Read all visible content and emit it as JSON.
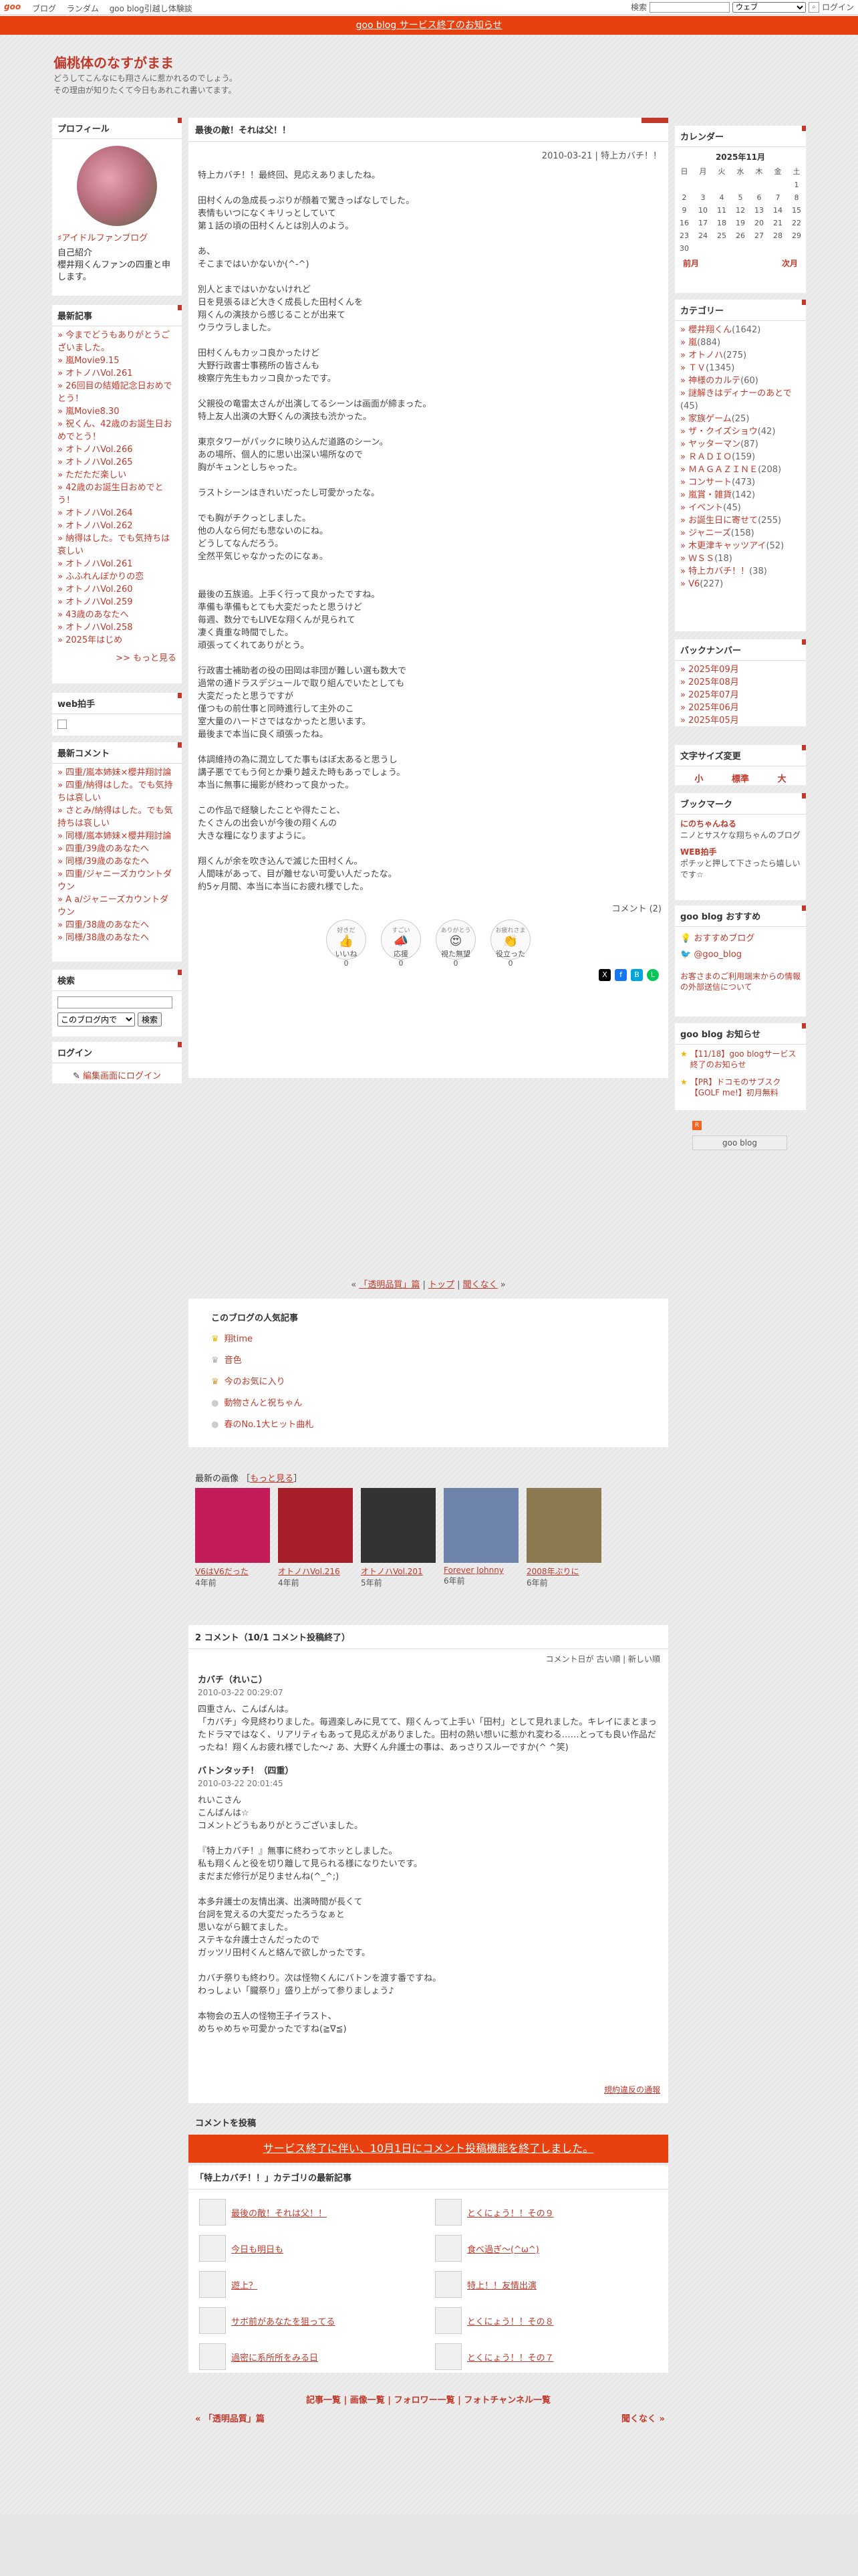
{
  "topbar": {
    "logo": "goo",
    "links": [
      "ブログ",
      "ランダム",
      "goo blog引越し体験談"
    ],
    "search_label": "検索",
    "search_select": "ウェブ",
    "login": "ログイン"
  },
  "notice": "goo blog サービス終了のお知らせ",
  "blog": {
    "title": "偏桃体のなすがまま",
    "desc1": "どうしてこんなにも翔さんに惹かれるのでしょう。",
    "desc2": "その理由が知りたくて今日もあれこれ書いてます。"
  },
  "profile": {
    "heading": "プロフィール",
    "fan": "♯アイドルファンブログ",
    "intro_label": "自己紹介",
    "intro": "櫻井翔くんファンの四重と申します。"
  },
  "recent": {
    "heading": "最新記事",
    "items": [
      "今までどうもありがとうございました。",
      "嵐Movie9.15",
      "オトノハVol.261",
      "26回目の結婚記念日おめでとう！",
      "嵐Movie8.30",
      "祝くん、42歳のお誕生日おめでとう！",
      "オトノハVol.266",
      "オトノハVol.265",
      "ただただ楽しい",
      "42歳のお誕生日おめでとう！",
      "オトノハVol.264",
      "オトノハVol.262",
      "納得はした。でも気持ちは哀しい",
      "オトノハVol.261",
      "ふふれんぼかりの恋",
      "オトノハVol.260",
      "オトノハVol.259",
      "43歳のあなたへ",
      "オトノハVol.258",
      "2025年はじめ"
    ],
    "more": ">> もっと見る"
  },
  "webclap": {
    "heading": "web拍手"
  },
  "comments": {
    "heading": "最新コメント",
    "items": [
      "四重/嵐本姉妹×櫻井翔討論",
      "四重/納得はした。でも気持ちは哀しい",
      "さとみ/納得はした。でも気持ちは哀しい",
      "同様/嵐本姉妹×櫻井翔討論",
      "四重/39歳のあなたへ",
      "同様/39歳のあなたへ",
      "四重/ジャニーズカウントダウン",
      "A a/ジャニーズカウントダウン",
      "四重/38歳のあなたへ",
      "同様/38歳のあなたへ"
    ]
  },
  "search": {
    "heading": "検索",
    "select": "このブログ内で",
    "button": "検索"
  },
  "login": {
    "heading": "ログイン",
    "link": "編集画面にログイン"
  },
  "article": {
    "heading": "最後の敵！それは父！！",
    "meta": "2010-03-21 | 特上カバチ！！",
    "body": "特上カバチ！！最終回、見応えありましたね。\n\n田村くんの急成長っぷりが顔着で驚きっぱなしでした。\n表情もいつになくキリっとしていて\n第１話の頃の田村くんとは別人のよう。\n\nあ、\nそこまではいかないか(^-^)\n\n別人とまではいかないけれど\n日を見張るほど大きく成長した田村くんを\n翔くんの演技から感じることが出来て\nウラウラしました。\n\n田村くんもカッコ良かったけど\n大野行政書士事務所の皆さんも\n検察庁先生もカッコ良かったです。\n\n父親役の竜雷太さんが出演してるシーンは画面が締まった。\n特上友人出演の大野くんの演技も渋かった。\n\n東京タワーがパックに映り込んだ道路のシーン。\nあの場所、個人的に思い出深い場所なので\n胸がキュンとしちゃった。\n\nラストシーンはきれいだったし可愛かったな。\n\nでも胸がチクっとしました。\n他の人なら何だも悲ないのにね。\nどうしてなんだろう。\n全然平気じゃなかったのになぁ。\n\n\n最後の五族追。上手く行って良かったですね。\n準備も準備もとても大変だったと思うけど\n毎週、数分でもLIVEな翔くんが見られて\n凄く貴重な時間でした。\n頑張ってくれてありがとう。\n\n行政書士補助者の役の田岡は非団が難しい選も数大で\n過常の通ドラスデジュールで取り組んでいたとしても\n大変だったと思うですが\n僅つもの前仕事と同時進行して主外のこ\n室大量のハードさではなかったと思います。\n最後まで本当に良く頑張ったね。\n\n体調維持の為に潤立してた事もはぼ太あると思うし\n講子悪でてもう何とか乗り越えた時もあっでしょう。\n本当に無事に撮影が終わって良かった。\n\nこの作品で経験したことや得たこと、\nたくさんの出会いが今後の翔くんの\n大きな糧になりますように。\n\n翔くんが余を吹き込んで滅じた田村くん。\n人間味があって、目が離せない可愛い人だったな。\n約5ヶ月間、本当に本当にお疲れ様でした。",
    "comment_link": "コメント (2)",
    "reactions": [
      {
        "top": "好きだ",
        "label": "いいね",
        "count": "0"
      },
      {
        "top": "すごい",
        "label": "応援",
        "count": "0"
      },
      {
        "top": "ありがとう",
        "label": "視た無望",
        "count": "0"
      },
      {
        "top": "お疲れさま",
        "label": "役立った",
        "count": "0"
      }
    ]
  },
  "calendar": {
    "heading": "カレンダー",
    "month": "2025年11月",
    "dow": [
      "日",
      "月",
      "火",
      "水",
      "木",
      "金",
      "土"
    ],
    "weeks": [
      [
        "",
        "",
        "",
        "",
        "",
        "",
        "1"
      ],
      [
        "2",
        "3",
        "4",
        "5",
        "6",
        "7",
        "8"
      ],
      [
        "9",
        "10",
        "11",
        "12",
        "13",
        "14",
        "15"
      ],
      [
        "16",
        "17",
        "18",
        "19",
        "20",
        "21",
        "22"
      ],
      [
        "23",
        "24",
        "25",
        "26",
        "27",
        "28",
        "29"
      ],
      [
        "30",
        "",
        "",
        "",
        "",
        "",
        ""
      ]
    ],
    "prev": "前月",
    "next": "次月"
  },
  "category": {
    "heading": "カテゴリー",
    "items": [
      {
        "n": "櫻井翔くん",
        "c": "(1642)"
      },
      {
        "n": "嵐",
        "c": "(884)"
      },
      {
        "n": "オトノハ",
        "c": "(275)"
      },
      {
        "n": "ＴＶ",
        "c": "(1345)"
      },
      {
        "n": "神様のカルテ",
        "c": "(60)"
      },
      {
        "n": "謎解きはディナーのあとで",
        "c": "(45)"
      },
      {
        "n": "家族ゲーム",
        "c": "(25)"
      },
      {
        "n": "ザ・クイズショウ",
        "c": "(42)"
      },
      {
        "n": "ヤッターマン",
        "c": "(87)"
      },
      {
        "n": "ＲＡＤＩＯ",
        "c": "(159)"
      },
      {
        "n": "ＭＡＧＡＺＩＮＥ",
        "c": "(208)"
      },
      {
        "n": "コンサート",
        "c": "(473)"
      },
      {
        "n": "嵐賞・雑貨",
        "c": "(142)"
      },
      {
        "n": "イベント",
        "c": "(45)"
      },
      {
        "n": "お誕生日に寄せて",
        "c": "(255)"
      },
      {
        "n": "ジャニーズ",
        "c": "(158)"
      },
      {
        "n": "木更津キャッツアイ",
        "c": "(52)"
      },
      {
        "n": "ＷＳＳ",
        "c": "(18)"
      },
      {
        "n": "特上カバチ！！",
        "c": "(38)"
      },
      {
        "n": "V6",
        "c": "(227)"
      }
    ]
  },
  "backnumber": {
    "heading": "バックナンバー",
    "items": [
      "2025年09月",
      "2025年08月",
      "2025年07月",
      "2025年06月",
      "2025年05月"
    ]
  },
  "fontsize": {
    "heading": "文字サイズ変更",
    "s": "小",
    "m": "標準",
    "l": "大"
  },
  "bookmark": {
    "heading": "ブックマーク",
    "items": [
      {
        "t": "にのちゃんねる",
        "d": "ニノとサスケな翔ちゃんのブログ"
      },
      {
        "t": "WEB拍手",
        "d": "ポチッと押して下さったら嬉しいです☆"
      }
    ]
  },
  "recommend": {
    "heading": "goo blog おすすめ",
    "items": [
      "おすすめブログ",
      "@goo_blog"
    ],
    "notice": "お客さまのご利用端末からの情報の外部送信について"
  },
  "gooinfo": {
    "heading": "goo blog お知らせ",
    "items": [
      "【11/18】goo blogサービス終了のお知らせ",
      "【PR】ドコモのサブスク【GOLF me!】初月無料"
    ],
    "badge": "goo blog"
  },
  "nav": {
    "prev": "「透明品質」篇",
    "top": "トップ",
    "next": "聞くなく"
  },
  "popular": {
    "heading": "このブログの人気記事",
    "items": [
      "翔time",
      "音色",
      "今のお気に入り",
      "動物さんと祝ちゃん",
      "春のNo.1大ヒット曲札"
    ]
  },
  "latest_images": {
    "heading": "最新の画像",
    "more": "もっと見る",
    "items": [
      {
        "t": "V6はV6だった",
        "d": "4年前",
        "c": "#c21d5a"
      },
      {
        "t": "オトノハVol.216",
        "d": "4年前",
        "c": "#a71f2a"
      },
      {
        "t": "オトノハVol.201",
        "d": "5年前",
        "c": "#333"
      },
      {
        "t": "Forever Johnny",
        "d": "6年前",
        "c": "#6d83a9"
      },
      {
        "t": "2008年ぶりに",
        "d": "6年前",
        "c": "#8c7b52"
      }
    ]
  },
  "comment_section": {
    "heading": "2 コメント（10/1 コメント投稿終了）",
    "sort": "コメント日が 古い順 | 新しい順",
    "items": [
      {
        "who": "カバチ（れいこ）",
        "when": "2010-03-22 00:29:07",
        "txt": "四重さん、こんばんは。\n「カバチ」今見終わりました。毎週楽しみに見てて、翔くんって上手い「田村」として見れました。キレイにまとまったドラマではなく、リアリティもあって見応えがありました。田村の熱い想いに惹かれ変わる……とっても良い作品だったね！翔くんお疲れ様でした～♪ あ、大野くん弁護士の事は、あっさりスルーですか(^ ^笑)"
      },
      {
        "who": "バトンタッチ！（四重）",
        "when": "2010-03-22 20:01:45",
        "txt": "れいこさん\nこんばんは☆\nコメントどうもありがとうございました。\n\n『特上カバチ！』無事に終わってホッとしました。\n私も翔くんと役を切り離して見られる様になりたいです。\nまだまだ修行が足りませんね(^_^;)\n\n本多弁護士の友情出演、出演時間が長くて\n台詞を覚えるの大変だったろうなぁと\n思いながら観てました。\nステキな弁護士さんだったので\nガッツリ田村くんと絡んで欲しかったです。\n\nカバチ祭りも終わり。次は怪物くんにバトンを渡す番ですね。\nわっしょい「朧祭り」盛り上がって参りましょう♪\n\n本物会の五人の怪物王子イラスト、\nめちゃめちゃ可愛かったですね(≧∇≦)"
      }
    ],
    "report": "規約違反の通報"
  },
  "post": {
    "heading": "コメントを投稿",
    "banner": "サービス終了に伴い、10月1日にコメント投稿機能を終了しました。"
  },
  "catlatest": {
    "heading": "「特上カバチ！！」カテゴリの最新記事",
    "items": [
      "最後の敵！それは父！！",
      "とくにょう！！その９",
      "今日も明日も",
      "食べ過ぎ〜(^ω^)",
      "遊上？",
      "特上！！友情出演",
      "サボ前があなたを狙ってる",
      "とくにょう！！その８",
      "過密に系所所をみる日",
      "とくにょう！！その７"
    ]
  },
  "footer": {
    "links": "記事一覧 | 画像一覧 | フォロワー一覧 | フォトチャンネル一覧",
    "prev": "« 「透明品質」篇",
    "next": "聞くなく »"
  }
}
